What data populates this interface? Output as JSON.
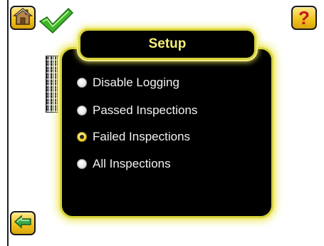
{
  "title": "Setup",
  "toolbar": {
    "home_icon": "home-icon",
    "help_icon": "help-icon",
    "help_glyph": "?",
    "back_icon": "back-arrow-icon",
    "status_icon": "checkmark-icon"
  },
  "logging_options": [
    {
      "label": "Disable Logging",
      "selected": false
    },
    {
      "label": "Passed Inspections",
      "selected": false
    },
    {
      "label": "Failed Inspections",
      "selected": true
    },
    {
      "label": "All Inspections",
      "selected": false
    }
  ],
  "colors": {
    "accent_yellow": "#f2c420",
    "dialog_border": "#d8d23a",
    "title_text": "#f5f07a",
    "check_green": "#3fb52b",
    "back_arrow_green": "#3aa94a"
  }
}
